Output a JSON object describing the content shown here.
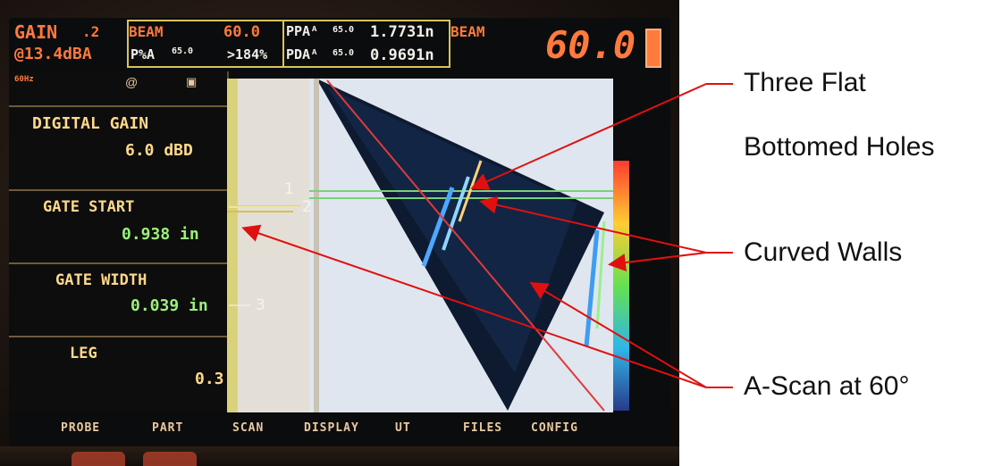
{
  "header": {
    "gain_label": "GAIN",
    "gain_step": ".2",
    "gain_value": "@13.4dBA",
    "beam_label": "BEAM",
    "beam_value": "60.0",
    "pxa_label": "P%A",
    "pxa_sub": "65.0",
    "pxa_value": ">184%",
    "ppa_label": "PPAᴬ",
    "ppa_sub": "65.0",
    "ppa_value": "1.7731n",
    "pda_label": "PDAᴬ",
    "pda_sub": "65.0",
    "pda_value": "0.9691n",
    "beam2_label": "BEAM",
    "big_beam": "60.0"
  },
  "side": {
    "freq": "60Hz",
    "digital_gain_label": "DIGITAL GAIN",
    "digital_gain_value": "6.0 dBD",
    "gate_start_label": "GATE START",
    "gate_start_value": "0.938 in",
    "gate_width_label": "GATE WIDTH",
    "gate_width_value": "0.039 in",
    "leg_label": "LEG",
    "leg_value": "0.3"
  },
  "menu": [
    "PROBE",
    "PART",
    "SCAN",
    "DISPLAY",
    "UT",
    "FILES",
    "CONFIG"
  ],
  "markers": [
    "1",
    "2",
    "3"
  ],
  "annotations": {
    "three_flat_line1": "Three Flat",
    "three_flat_line2": "Bottomed Holes",
    "curved_walls": "Curved Walls",
    "ascan": "A-Scan at 60°"
  },
  "colors": {
    "annotation_arrow": "#e01010",
    "header_orange": "#ff7a3c",
    "value_green": "#9cf07a"
  }
}
